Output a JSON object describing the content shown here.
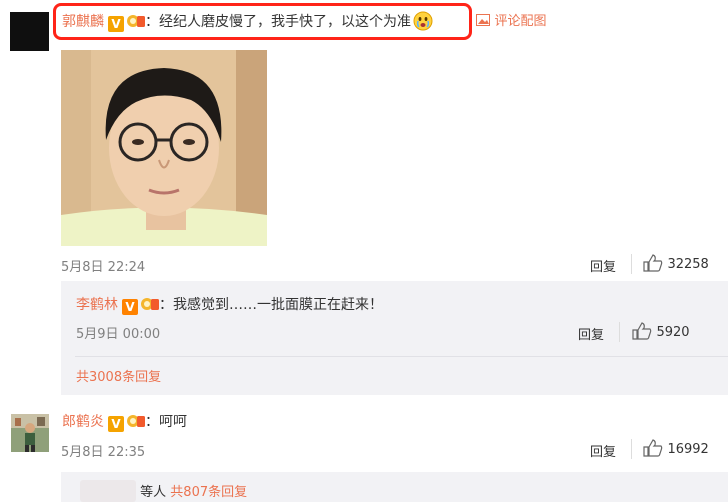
{
  "comment1": {
    "username": "郭麒麟",
    "verified_badge": "V",
    "text": "：经纪人磨皮慢了，我手快了，以这个为准",
    "emoji": "crying-face-emoji",
    "pic_link": "评论配图",
    "date": "5月8日 22:24",
    "reply_label": "回复",
    "likes": "32258"
  },
  "reply1": {
    "username": "李鹤林",
    "verified_badge": "V",
    "text": "：我感觉到……一批面膜正在赶来！",
    "date": "5月9日 00:00",
    "reply_label": "回复",
    "likes": "5920"
  },
  "more_replies": "共3008条回复",
  "comment2": {
    "username": "郎鹤炎",
    "verified_badge": "V",
    "text": "：呵呵",
    "date": "5月8日 22:35",
    "reply_label": "回复",
    "likes": "16992"
  },
  "bottom": {
    "others": "等人",
    "replies": "共807条回复"
  },
  "colors": {
    "accent": "#eb7350",
    "highlight_border": "#ff2418",
    "reply_bg": "#f2f2f5"
  }
}
